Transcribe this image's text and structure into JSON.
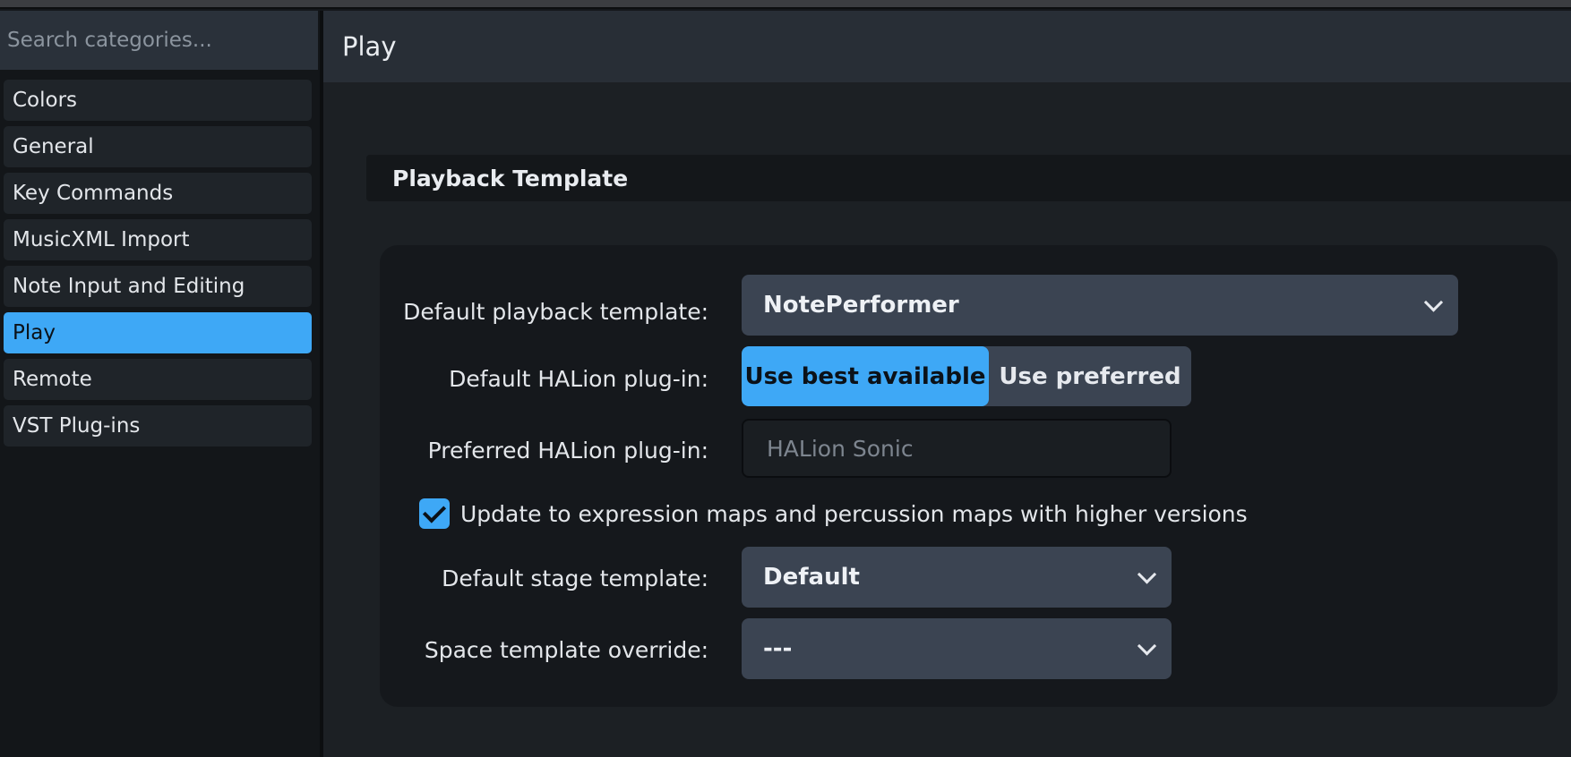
{
  "search": {
    "placeholder": "Search categories..."
  },
  "categories": [
    {
      "label": "Colors"
    },
    {
      "label": "General"
    },
    {
      "label": "Key Commands"
    },
    {
      "label": "MusicXML Import"
    },
    {
      "label": "Note Input and Editing"
    },
    {
      "label": "Play",
      "selected": true
    },
    {
      "label": "Remote"
    },
    {
      "label": "VST Plug-ins"
    }
  ],
  "page": {
    "title": "Play"
  },
  "section": {
    "title": "Playback Template"
  },
  "settings": {
    "playback_template": {
      "label": "Default playback template:",
      "value": "NotePerformer",
      "icon": "chevron-down-icon"
    },
    "halion_plugin": {
      "label": "Default HALion plug-in:",
      "options": [
        "Use best available",
        "Use preferred"
      ],
      "selected": "Use best available"
    },
    "preferred_halion": {
      "label": "Preferred HALion plug-in:",
      "placeholder": "HALion Sonic",
      "value": ""
    },
    "update_maps": {
      "label": "Update to expression maps and percussion maps with higher versions",
      "checked": true
    },
    "stage_template": {
      "label": "Default stage template:",
      "value": "Default",
      "icon": "chevron-down-icon"
    },
    "space_override": {
      "label": "Space template override:",
      "value": "---",
      "icon": "chevron-down-icon"
    }
  },
  "colors": {
    "accent": "#3ea8f6",
    "sidebar_item": "#1f2429",
    "control": "#3b4452",
    "panel": "#15181c"
  }
}
